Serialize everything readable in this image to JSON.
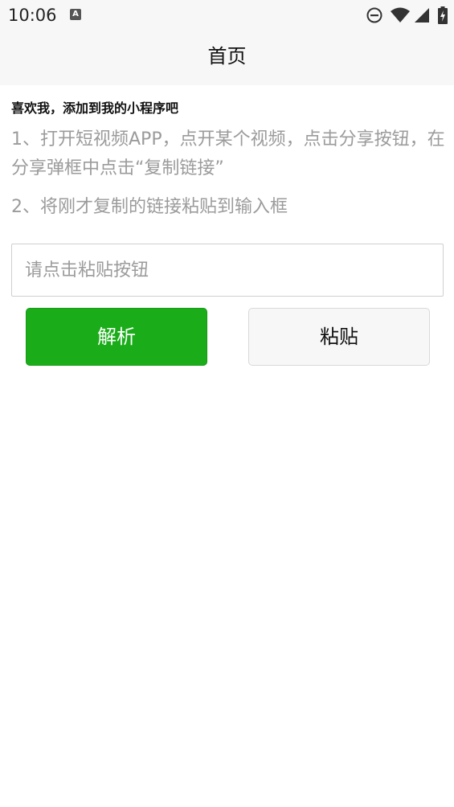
{
  "status_bar": {
    "time": "10:06",
    "notification_icon_label": "A",
    "icons": [
      "do-not-disturb-icon",
      "wifi-icon",
      "cell-signal-icon",
      "battery-charging-icon"
    ]
  },
  "nav": {
    "title": "首页"
  },
  "main": {
    "intro": "喜欢我，添加到我的小程序吧",
    "steps": [
      "1、打开短视频APP，点开某个视频，点击分享按钮，在分享弹框中点击“复制链接”",
      "2、将刚才复制的链接粘贴到输入框"
    ],
    "input": {
      "value": "",
      "placeholder": "请点击粘贴按钮"
    },
    "buttons": {
      "parse_label": "解析",
      "paste_label": "粘贴"
    }
  },
  "colors": {
    "primary_green": "#1aad19",
    "nav_background": "#f7f7f7",
    "muted_text": "#9b9b9b"
  }
}
